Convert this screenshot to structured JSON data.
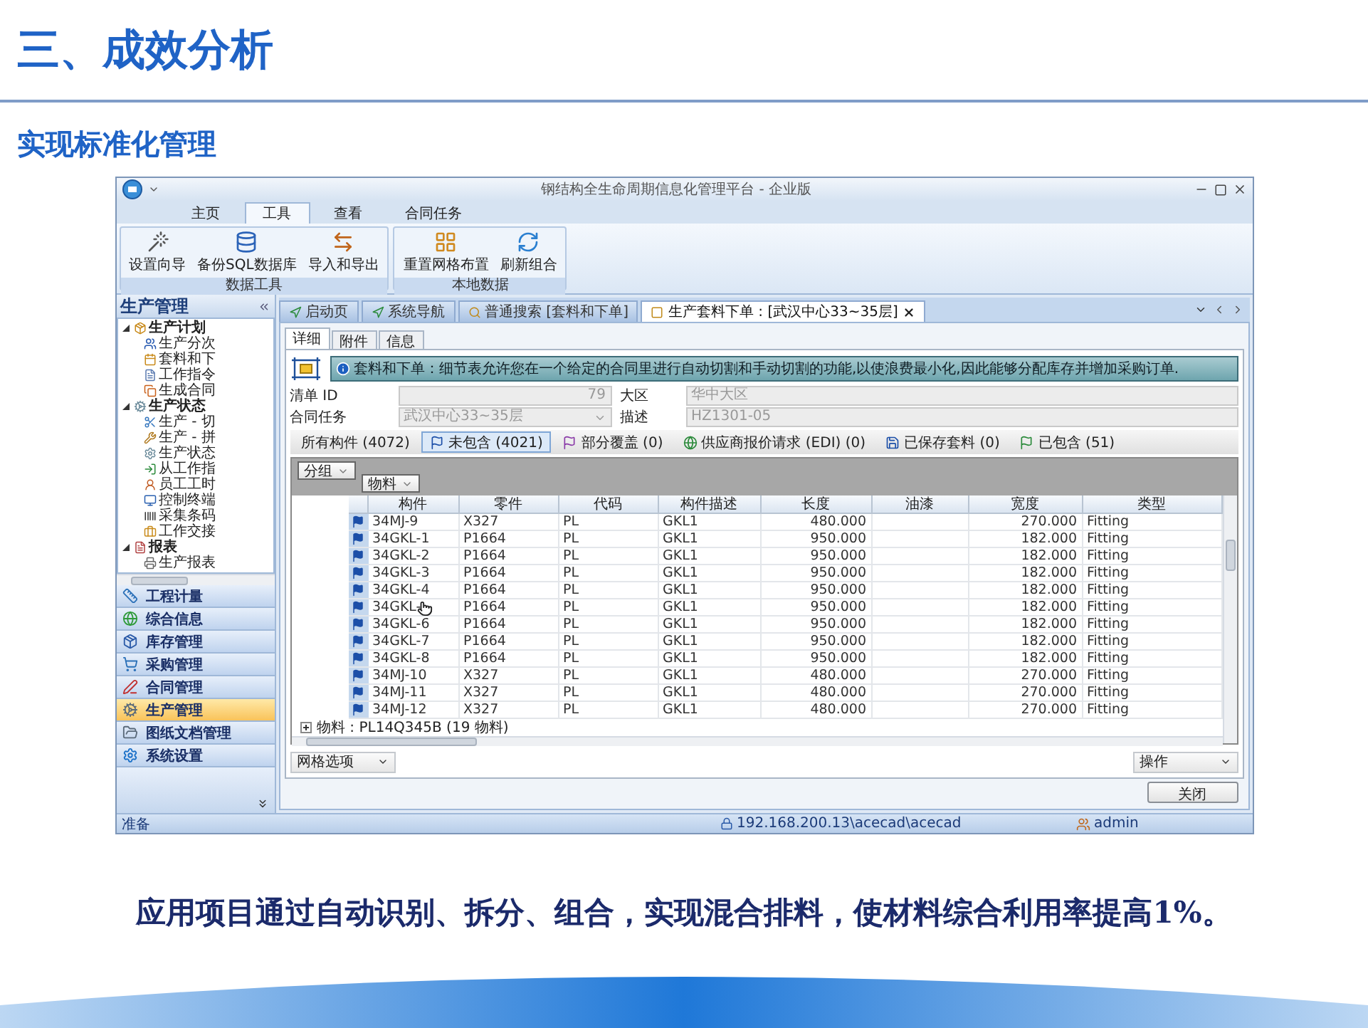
{
  "title": "三、成效分析",
  "subtitle": "实现标准化管理",
  "window": {
    "title": "钢结构全生命周期信息化管理平台 - 企业版"
  },
  "ribbon_tabs": [
    {
      "label": "主页",
      "selected": false
    },
    {
      "label": "工具",
      "selected": true
    },
    {
      "label": "查看",
      "selected": false
    },
    {
      "label": "合同任务",
      "selected": false
    }
  ],
  "ribbon_groups": [
    {
      "label": "数据工具",
      "buttons": [
        "设置向导",
        "备份SQL数据库",
        "导入和导出"
      ]
    },
    {
      "label": "本地数据",
      "buttons": [
        "重置网格布置",
        "刷新组合"
      ]
    }
  ],
  "sidebar": {
    "title": "生产管理",
    "tree": [
      {
        "label": "生产计划",
        "expanded": true,
        "children": [
          {
            "label": "生产分次"
          },
          {
            "label": "套料和下"
          },
          {
            "label": "工作指令"
          },
          {
            "label": "生成合同"
          }
        ]
      },
      {
        "label": "生产状态",
        "expanded": true,
        "children": [
          {
            "label": "生产 - 切"
          },
          {
            "label": "生产 - 拼"
          },
          {
            "label": "生产状态"
          },
          {
            "label": "从工作指"
          },
          {
            "label": "员工工时"
          },
          {
            "label": "控制终端"
          },
          {
            "label": "采集条码"
          },
          {
            "label": "工作交接"
          }
        ]
      },
      {
        "label": "报表",
        "expanded": true,
        "children": [
          {
            "label": "生产报表"
          }
        ]
      }
    ],
    "nav": [
      {
        "label": "工程计量",
        "selected": false
      },
      {
        "label": "综合信息",
        "selected": false
      },
      {
        "label": "库存管理",
        "selected": false
      },
      {
        "label": "采购管理",
        "selected": false
      },
      {
        "label": "合同管理",
        "selected": false
      },
      {
        "label": "生产管理",
        "selected": true
      },
      {
        "label": "图纸文档管理",
        "selected": false
      },
      {
        "label": "系统设置",
        "selected": false
      }
    ]
  },
  "doc_tabs": [
    {
      "label": "启动页",
      "selected": false
    },
    {
      "label": "系统导航",
      "selected": false
    },
    {
      "label": "普通搜索 [套料和下单]",
      "selected": false
    },
    {
      "label": "生产套料下单 : [武汉中心33~35层]",
      "selected": true
    }
  ],
  "detail_tabs": [
    {
      "label": "详细",
      "selected": true
    },
    {
      "label": "附件",
      "selected": false
    },
    {
      "label": "信息",
      "selected": false
    }
  ],
  "banner": "套料和下单：细节表允许您在一个给定的合同里进行自动切割和手动切割的功能,以使浪费最小化,因此能够分配库存并增加采购订单.",
  "form": [
    {
      "label": "清单 ID",
      "value": "79",
      "kind": "number",
      "disabled": true
    },
    {
      "label": "大区",
      "value": "华中大区",
      "kind": "text",
      "disabled": true
    },
    {
      "label": "合同任务",
      "value": "武汉中心33~35层",
      "kind": "dropdown",
      "disabled": true
    },
    {
      "label": "描述",
      "value": "HZ1301-05",
      "kind": "text",
      "disabled": true
    }
  ],
  "filter_tabs": [
    {
      "label": "所有构件 (4072)",
      "selected": false
    },
    {
      "label": "未包含 (4021)",
      "selected": true
    },
    {
      "label": "部分覆盖 (0)",
      "selected": false
    },
    {
      "label": "供应商报价请求 (EDI) (0)",
      "selected": false
    },
    {
      "label": "已保存套料 (0)",
      "selected": false
    },
    {
      "label": "已包含 (51)",
      "selected": false
    }
  ],
  "group_by": [
    "分组",
    "物料"
  ],
  "table": {
    "columns": [
      "构件",
      "零件",
      "代码",
      "构件描述",
      "长度",
      "油漆",
      "宽度",
      "类型"
    ],
    "rows": [
      {
        "cells": [
          "34MJ-9",
          "X327",
          "PL",
          "GKL1",
          "480.000",
          "",
          "270.000",
          "Fitting"
        ]
      },
      {
        "cells": [
          "34GKL-1",
          "P1664",
          "PL",
          "GKL1",
          "950.000",
          "",
          "182.000",
          "Fitting"
        ]
      },
      {
        "cells": [
          "34GKL-2",
          "P1664",
          "PL",
          "GKL1",
          "950.000",
          "",
          "182.000",
          "Fitting"
        ]
      },
      {
        "cells": [
          "34GKL-3",
          "P1664",
          "PL",
          "GKL1",
          "950.000",
          "",
          "182.000",
          "Fitting"
        ]
      },
      {
        "cells": [
          "34GKL-4",
          "P1664",
          "PL",
          "GKL1",
          "950.000",
          "",
          "182.000",
          "Fitting"
        ]
      },
      {
        "cells": [
          "34GKL-",
          "P1664",
          "PL",
          "GKL1",
          "950.000",
          "",
          "182.000",
          "Fitting"
        ]
      },
      {
        "cells": [
          "34GKL-6",
          "P1664",
          "PL",
          "GKL1",
          "950.000",
          "",
          "182.000",
          "Fitting"
        ]
      },
      {
        "cells": [
          "34GKL-7",
          "P1664",
          "PL",
          "GKL1",
          "950.000",
          "",
          "182.000",
          "Fitting"
        ]
      },
      {
        "cells": [
          "34GKL-8",
          "P1664",
          "PL",
          "GKL1",
          "950.000",
          "",
          "182.000",
          "Fitting"
        ]
      },
      {
        "cells": [
          "34MJ-10",
          "X327",
          "PL",
          "GKL1",
          "480.000",
          "",
          "270.000",
          "Fitting"
        ]
      },
      {
        "cells": [
          "34MJ-11",
          "X327",
          "PL",
          "GKL1",
          "480.000",
          "",
          "270.000",
          "Fitting"
        ]
      },
      {
        "cells": [
          "34MJ-12",
          "X327",
          "PL",
          "GKL1",
          "480.000",
          "",
          "270.000",
          "Fitting"
        ]
      }
    ],
    "group_row": {
      "label": "物料 : PL14Q345B (19 物料)",
      "expanded": false
    }
  },
  "bottom_buttons": {
    "grid_options": "网格选项",
    "actions": "操作"
  },
  "close_button": "关闭",
  "status_bar": {
    "state": "准备",
    "connection": "192.168.200.13\\acecad\\acecad",
    "user": "admin"
  },
  "caption": "应用项目通过自动识别、拆分、组合，实现混合排料，使材料综合利用率提高1%。"
}
